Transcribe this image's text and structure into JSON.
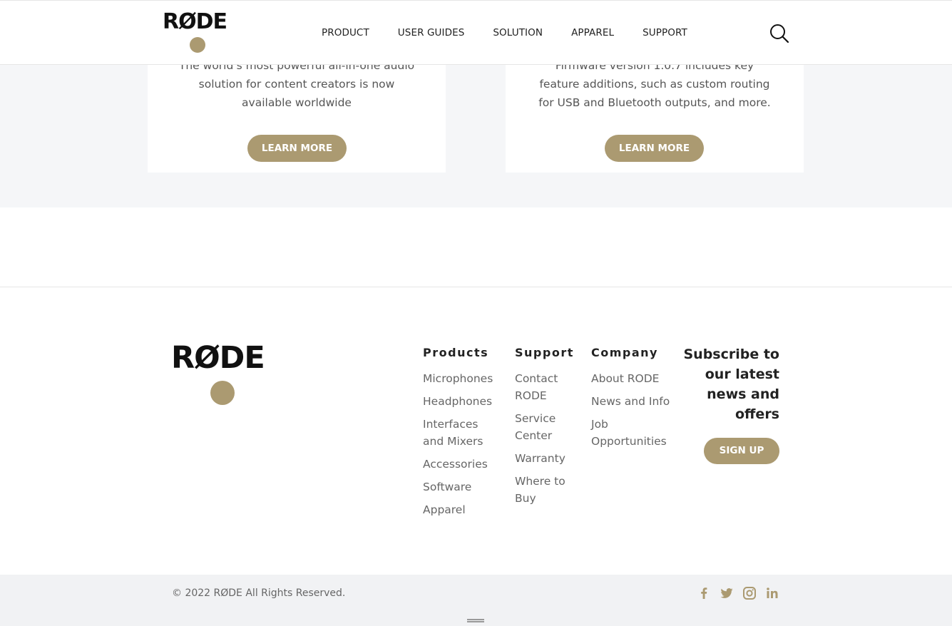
{
  "header": {
    "logo_text": "RØDE",
    "nav": [
      "PRODUCT",
      "USER GUIDES",
      "SOLUTION",
      "APPAREL",
      "SUPPORT"
    ],
    "search_icon": "search-icon"
  },
  "cards": [
    {
      "text": "The world's most powerful all-in-one audio solution for content creators is now available worldwide",
      "button": "LEARN MORE"
    },
    {
      "text": "Firmware version 1.0.7 includes key feature additions, such as custom routing for USB and Bluetooth outputs, and more.",
      "button": "LEARN MORE"
    }
  ],
  "footer": {
    "logo_text": "RØDE",
    "columns": {
      "products": {
        "title": "Products",
        "items": [
          "Microphones",
          "Headphones",
          "Interfaces and Mixers",
          "Accessories",
          "Software",
          "Apparel"
        ]
      },
      "support": {
        "title": "Support",
        "items": [
          "Contact RODE",
          "Service Center",
          "Warranty",
          "Where to Buy"
        ]
      },
      "company": {
        "title": "Company",
        "items": [
          "About RODE",
          "News and Info",
          "Job Opportunities"
        ]
      }
    },
    "subscribe": {
      "title": "Subscribe to our latest news and offers",
      "button": "SIGN UP"
    },
    "copyright": "© 2022 RØDE All Rights Reserved.",
    "social_icons": [
      "facebook-icon",
      "twitter-icon",
      "instagram-icon",
      "linkedin-icon"
    ]
  },
  "colors": {
    "accent": "#ab9a71",
    "band_bg": "#f5f6f8",
    "bottom_bg": "#f1f2f4"
  }
}
